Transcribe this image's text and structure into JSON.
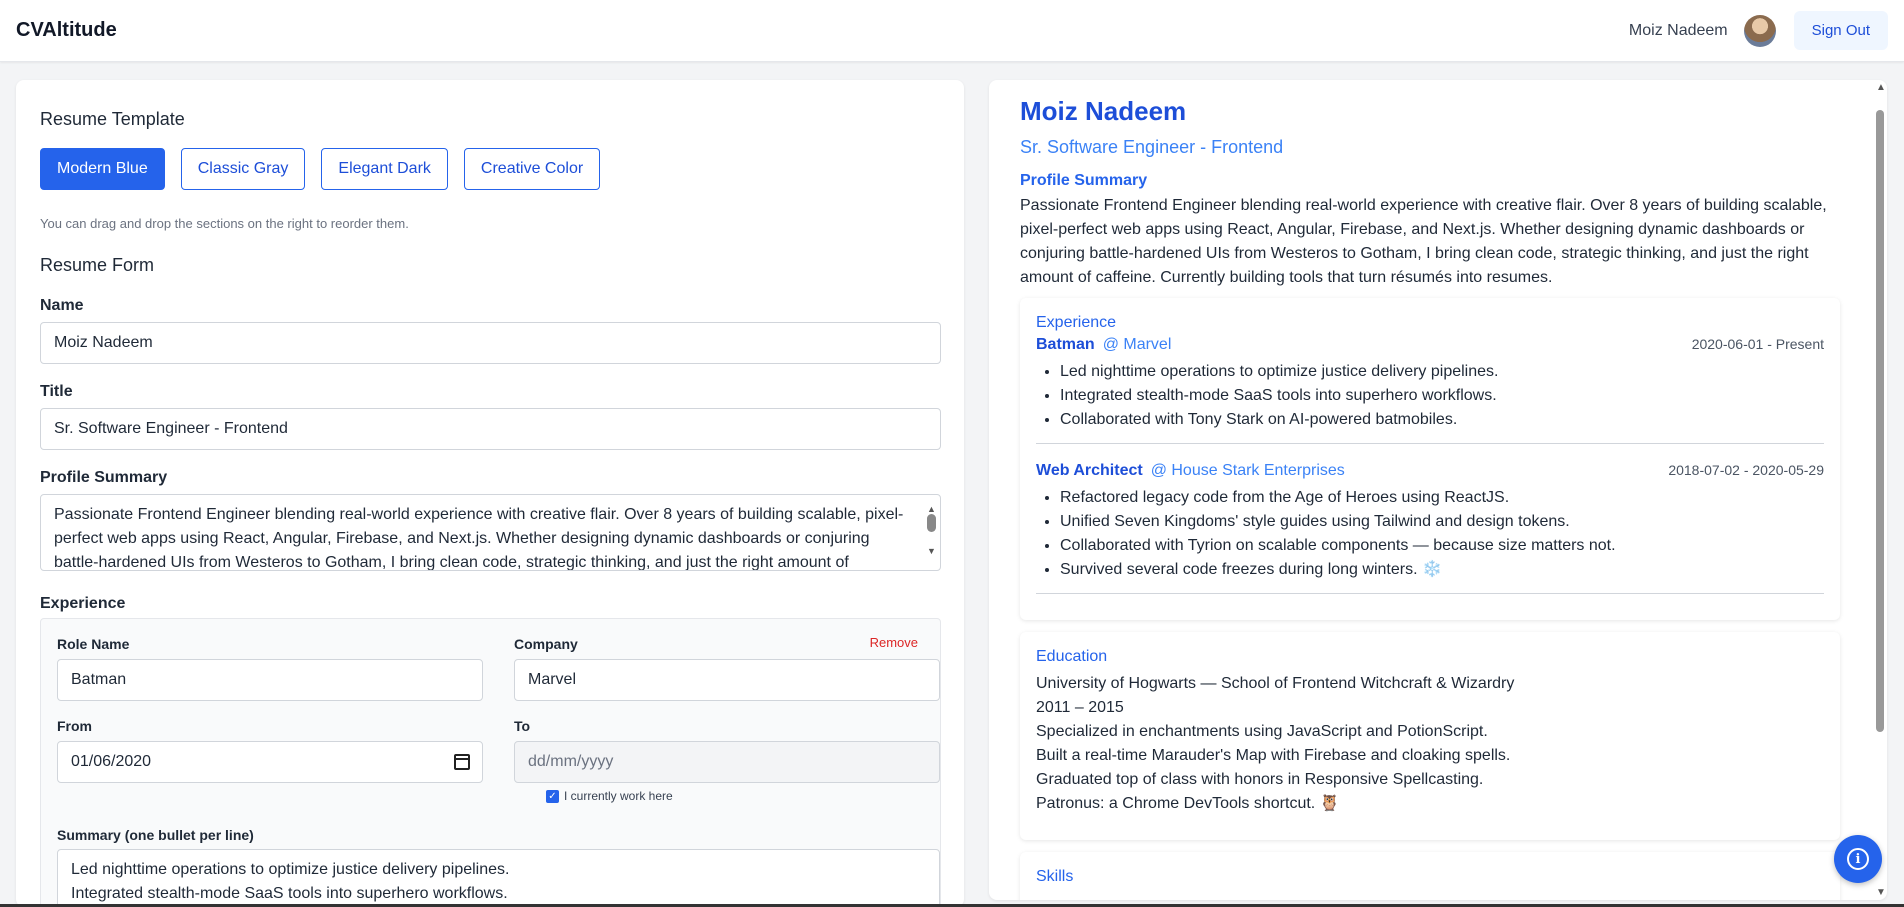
{
  "app": {
    "brand": "CVAltitude",
    "user_name": "Moiz Nadeem",
    "sign_out": "Sign Out"
  },
  "left": {
    "template_heading": "Resume Template",
    "templates": [
      "Modern Blue",
      "Classic Gray",
      "Elegant Dark",
      "Creative Color"
    ],
    "active_template": "Modern Blue",
    "hint": "You can drag and drop the sections on the right to reorder them.",
    "form_heading": "Resume Form",
    "name_label": "Name",
    "name_value": "Moiz Nadeem",
    "title_label": "Title",
    "title_value": "Sr. Software Engineer - Frontend",
    "summary_label": "Profile Summary",
    "summary_value": "Passionate Frontend Engineer blending real-world experience with creative flair. Over 8 years of building scalable, pixel-perfect web apps using React, Angular, Firebase, and Next.js. Whether designing dynamic dashboards or conjuring battle-hardened UIs from Westeros to Gotham, I bring clean code, strategic thinking, and just the right amount of caffeine.",
    "experience_label": "Experience",
    "exp": {
      "role_label": "Role Name",
      "role_value": "Batman",
      "company_label": "Company",
      "company_value": "Marvel",
      "remove": "Remove",
      "from_label": "From",
      "from_value": "01/06/2020",
      "to_label": "To",
      "to_placeholder": "dd/mm/yyyy",
      "current_label": "I currently work here",
      "current_checked": true,
      "summary_label": "Summary (one bullet per line)",
      "summary_lines": [
        "Led nighttime operations to optimize justice delivery pipelines.",
        "Integrated stealth-mode SaaS tools into superhero workflows."
      ]
    }
  },
  "preview": {
    "name": "Moiz Nadeem",
    "title": "Sr. Software Engineer - Frontend",
    "summary_heading": "Profile Summary",
    "summary": "Passionate Frontend Engineer blending real-world experience with creative flair. Over 8 years of building scalable, pixel-perfect web apps using React, Angular, Firebase, and Next.js. Whether designing dynamic dashboards or conjuring battle-hardened UIs from Westeros to Gotham, I bring clean code, strategic thinking, and just the right amount of caffeine. Currently building tools that turn résumés into resumes.",
    "experience_heading": "Experience",
    "jobs": [
      {
        "role": "Batman",
        "company": "@ Marvel",
        "dates": "2020-06-01 - Present",
        "bullets": [
          "Led nighttime operations to optimize justice delivery pipelines.",
          "Integrated stealth-mode SaaS tools into superhero workflows.",
          "Collaborated with Tony Stark on AI-powered batmobiles."
        ]
      },
      {
        "role": "Web Architect",
        "company": "@ House Stark Enterprises",
        "dates": "2018-07-02 - 2020-05-29",
        "bullets": [
          "Refactored legacy code from the Age of Heroes using ReactJS.",
          "Unified Seven Kingdoms' style guides using Tailwind and design tokens.",
          "Collaborated with Tyrion on scalable components — because size matters not.",
          "Survived several code freezes during long winters. ❄️"
        ]
      }
    ],
    "education_heading": "Education",
    "education_lines": [
      "University of Hogwarts — School of Frontend Witchcraft & Wizardry",
      "2011 – 2015",
      "Specialized in enchantments using JavaScript and PotionScript.",
      "Built a real-time Marauder's Map with Firebase and cloaking spells.",
      "Graduated top of class with honors in Responsive Spellcasting.",
      "Patronus: a Chrome DevTools shortcut. 🦉"
    ],
    "skills_heading": "Skills"
  },
  "icons": {
    "info": "info-icon",
    "calendar": "calendar-icon",
    "avatar": "user-avatar"
  },
  "colors": {
    "accent": "#2563eb",
    "danger": "#dc2626"
  }
}
